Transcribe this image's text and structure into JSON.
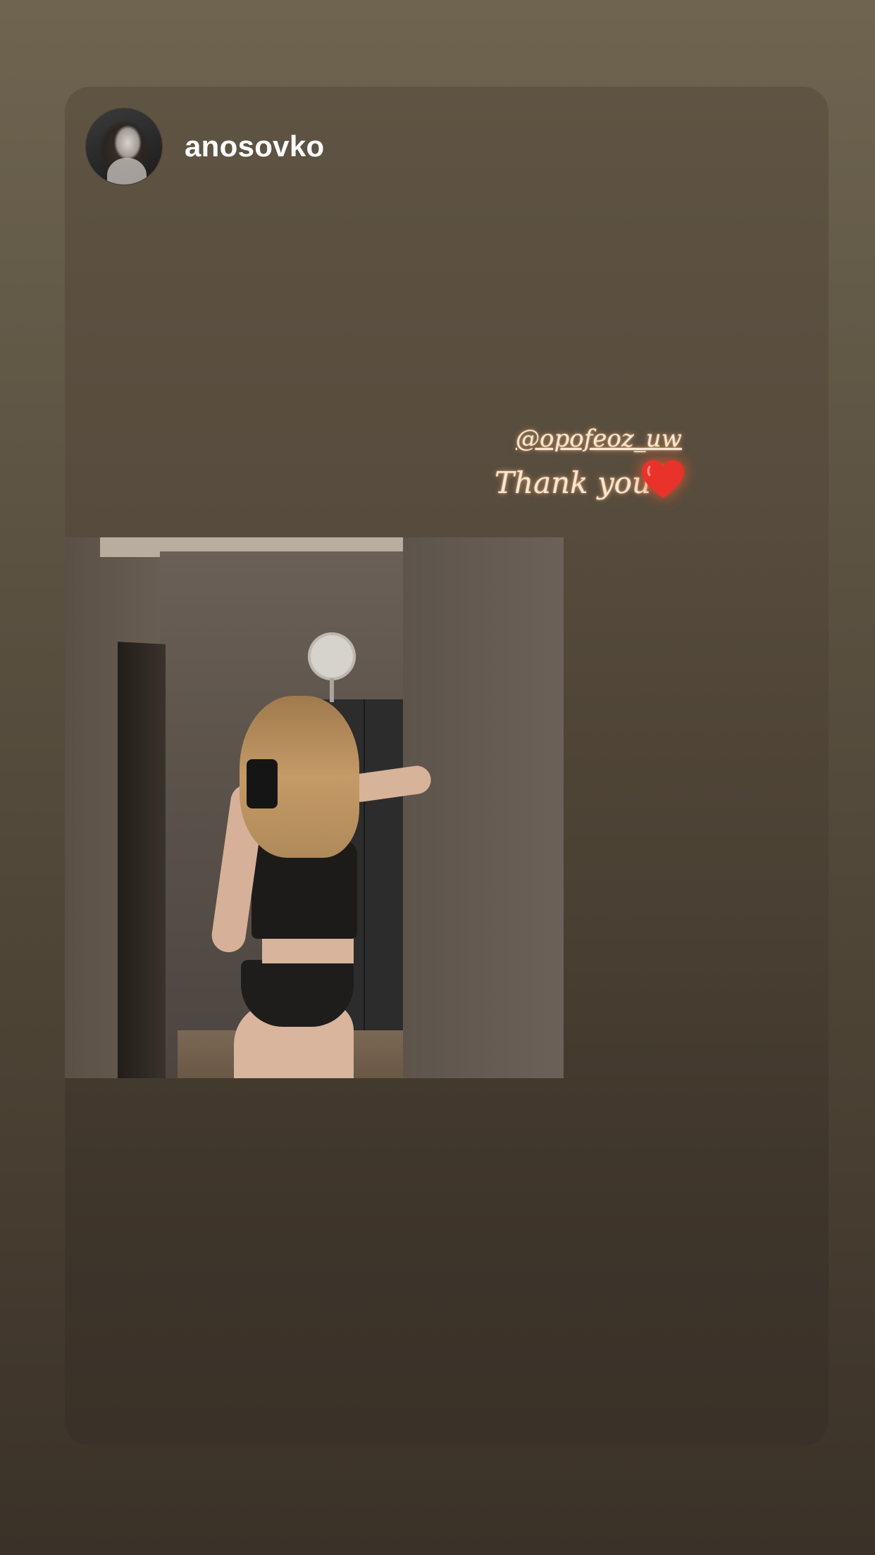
{
  "story": {
    "username": "anosovko",
    "sticker": {
      "mention": "@opofeoz_uw",
      "caption": "Thank you",
      "emoji": "heart-icon"
    }
  },
  "colors": {
    "background_top": "#6e6450",
    "background_bottom": "#3a3128",
    "sticker_text": "#f6e7d4",
    "heart": "#e8322a"
  }
}
